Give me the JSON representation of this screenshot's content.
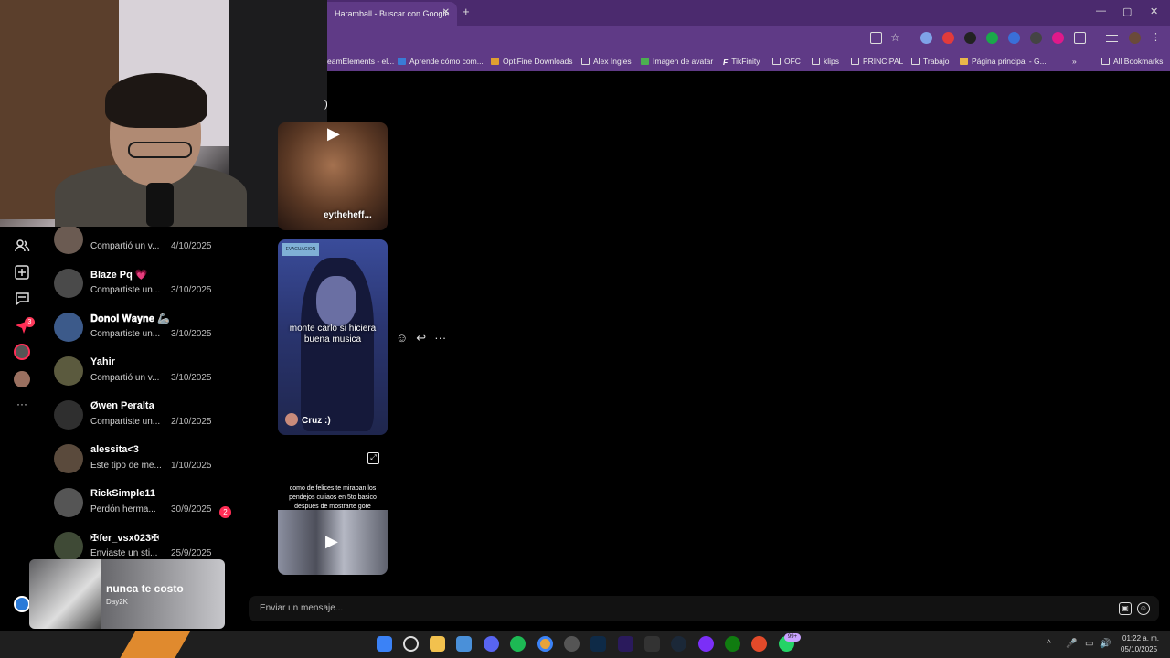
{
  "browser": {
    "tab_title": "Haramball - Buscar con Google",
    "tab_close": "✕",
    "new_tab": "+",
    "window_controls": [
      "—",
      "▢",
      "✕"
    ],
    "bookmarks": [
      "eamElements - el...",
      "Aprende cómo com...",
      "OptiFine Downloads",
      "Alex Ingles",
      "Imagen de avatar",
      "TikFinity",
      "OFC",
      "klips",
      "PRINCIPAL",
      "Trabajo",
      "Página principal - G...",
      "All Bookmarks"
    ],
    "bookmarks_overflow": "»"
  },
  "rail": {
    "icons": [
      "users-icon",
      "add-icon",
      "messages-icon",
      "send-icon",
      "profile-icon",
      "avatar-icon",
      "more-icon"
    ],
    "notification_count": "3",
    "more_label": "···"
  },
  "conversations": [
    {
      "name": "",
      "preview": "Compartió un v...",
      "date": "4/10/2025",
      "avatar_color": "#6b5b52"
    },
    {
      "name": "Blaze Pq 💗",
      "preview": "Compartiste un...",
      "date": "3/10/2025",
      "avatar_color": "#4a4a4a"
    },
    {
      "name": "𝐃𝐨𝐧𝐨𝐥 𝐖𝐚𝐲𝐧𝐞 🦾",
      "preview": "Compartiste un...",
      "date": "3/10/2025",
      "avatar_color": "#3c5a8a"
    },
    {
      "name": "Yahir",
      "preview": "Compartió un v...",
      "date": "3/10/2025",
      "avatar_color": "#5b5a3e"
    },
    {
      "name": "Øwen Peralta",
      "preview": "Compartiste un...",
      "date": "2/10/2025",
      "avatar_color": "#2f2f2f"
    },
    {
      "name": "alessita<3",
      "preview": "Este tipo de me...",
      "date": "1/10/2025",
      "avatar_color": "#5a4a3c"
    },
    {
      "name": "RickSimple11",
      "preview": "Perdón herma...",
      "date": "30/9/2025",
      "avatar_color": "#555555",
      "badge": "2"
    },
    {
      "name": "✠fer_vsx023✠",
      "preview": "Enviaste un sti...",
      "date": "25/9/2025",
      "avatar_color": "#3f4a36"
    }
  ],
  "chat": {
    "header_fragment": ")",
    "video1_caption": "eytheheff...",
    "video2": {
      "badge": "EVACUACION",
      "overlay": "monte carlo si hiciera buena musica",
      "author": "Cruz :)"
    },
    "video3_top": "como de felices te miraban los pendejos culiaos en 5to basico despues de mostrarte gore",
    "play_glyph": "▶",
    "actions": [
      "☺",
      "↩",
      "···"
    ],
    "expand_glyph": "⤢"
  },
  "composer": {
    "placeholder": "Enviar un mensaje...",
    "icons": [
      "image-icon",
      "emoji-icon"
    ]
  },
  "music_popup": {
    "title": "nunca te costo",
    "artist": "Day2K"
  },
  "taskbar": {
    "time": "01:22 a. m.",
    "date": "05/10/2025",
    "whatsapp_badge": "99+",
    "tray_glyphs": [
      "^",
      "🎤",
      "▭",
      "🔊"
    ]
  }
}
